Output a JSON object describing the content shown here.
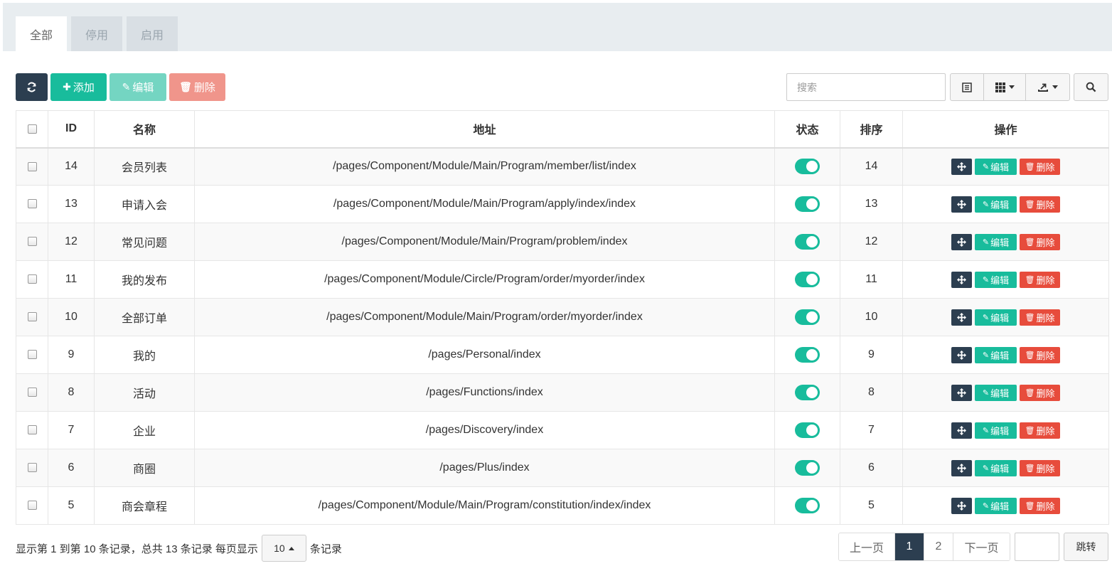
{
  "tabs": [
    {
      "label": "全部",
      "active": true
    },
    {
      "label": "停用",
      "active": false
    },
    {
      "label": "启用",
      "active": false
    }
  ],
  "toolbar": {
    "refresh_icon": "refresh-icon",
    "add_label": "添加",
    "edit_label": "编辑",
    "delete_label": "删除",
    "search_placeholder": "搜索",
    "colors": {
      "dark": "#2c3e50",
      "success": "#18bc9c",
      "danger": "#e74c3c"
    }
  },
  "table": {
    "headers": {
      "id": "ID",
      "name": "名称",
      "path": "地址",
      "status": "状态",
      "sort": "排序",
      "actions": "操作"
    },
    "action_labels": {
      "edit": "编辑",
      "delete": "删除"
    },
    "rows": [
      {
        "id": "14",
        "name": "会员列表",
        "path": "/pages/Component/Module/Main/Program/member/list/index",
        "status": true,
        "sort": "14"
      },
      {
        "id": "13",
        "name": "申请入会",
        "path": "/pages/Component/Module/Main/Program/apply/index/index",
        "status": true,
        "sort": "13"
      },
      {
        "id": "12",
        "name": "常见问题",
        "path": "/pages/Component/Module/Main/Program/problem/index",
        "status": true,
        "sort": "12"
      },
      {
        "id": "11",
        "name": "我的发布",
        "path": "/pages/Component/Module/Circle/Program/order/myorder/index",
        "status": true,
        "sort": "11"
      },
      {
        "id": "10",
        "name": "全部订单",
        "path": "/pages/Component/Module/Main/Program/order/myorder/index",
        "status": true,
        "sort": "10"
      },
      {
        "id": "9",
        "name": "我的",
        "path": "/pages/Personal/index",
        "status": true,
        "sort": "9"
      },
      {
        "id": "8",
        "name": "活动",
        "path": "/pages/Functions/index",
        "status": true,
        "sort": "8"
      },
      {
        "id": "7",
        "name": "企业",
        "path": "/pages/Discovery/index",
        "status": true,
        "sort": "7"
      },
      {
        "id": "6",
        "name": "商圈",
        "path": "/pages/Plus/index",
        "status": true,
        "sort": "6"
      },
      {
        "id": "5",
        "name": "商会章程",
        "path": "/pages/Component/Module/Main/Program/constitution/index/index",
        "status": true,
        "sort": "5"
      }
    ]
  },
  "footer": {
    "info_prefix": "显示第 1 到第 10 条记录，总共 13 条记录 每页显示",
    "page_size": "10",
    "info_suffix": "条记录",
    "prev_label": "上一页",
    "pages": [
      "1",
      "2"
    ],
    "current_page": "1",
    "next_label": "下一页",
    "jump_label": "跳转"
  }
}
